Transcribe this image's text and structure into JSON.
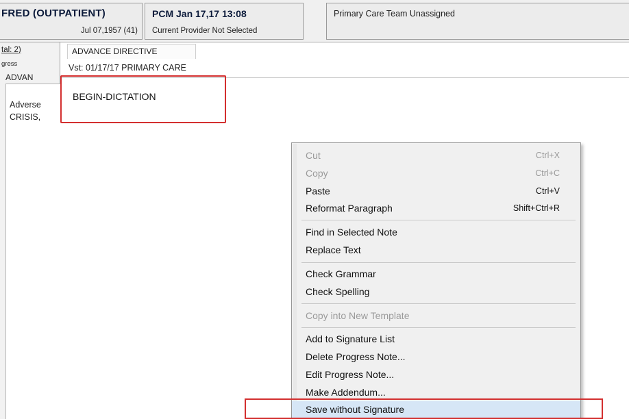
{
  "header": {
    "patient_name": "FRED (OUTPATIENT)",
    "patient_dob": "Jul 07,1957 (41)",
    "visit_title": "PCM Jan 17,17 13:08",
    "visit_provider": "Current Provider Not Selected",
    "team": "Primary Care Team Unassigned"
  },
  "left_panel": {
    "total_label": "tal: 2)",
    "progress_label": "gress",
    "selected_note": "ADVAN",
    "tree_line_1": "Adverse",
    "tree_line_2": "CRISIS,"
  },
  "note": {
    "title": "ADVANCE DIRECTIVE",
    "visit_line": "Vst: 01/17/17  PRIMARY CARE",
    "body_text": "BEGIN-DICTATION"
  },
  "context_menu": {
    "cut": {
      "label": "Cut",
      "shortcut": "Ctrl+X"
    },
    "copy": {
      "label": "Copy",
      "shortcut": "Ctrl+C"
    },
    "paste": {
      "label": "Paste",
      "shortcut": "Ctrl+V"
    },
    "reformat": {
      "label": "Reformat Paragraph",
      "shortcut": "Shift+Ctrl+R"
    },
    "find": {
      "label": "Find in Selected Note"
    },
    "replace": {
      "label": "Replace Text"
    },
    "grammar": {
      "label": "Check Grammar"
    },
    "spelling": {
      "label": "Check Spelling"
    },
    "copy_template": {
      "label": "Copy into New Template"
    },
    "add_signature": {
      "label": "Add to Signature List"
    },
    "delete_note": {
      "label": "Delete Progress Note..."
    },
    "edit_note": {
      "label": "Edit Progress Note..."
    },
    "addendum": {
      "label": "Make Addendum..."
    },
    "save_without_sig": {
      "label": "Save without Signature"
    }
  },
  "colors": {
    "highlight_outline": "#d32f2f",
    "menu_hover": "#d6e6f6",
    "header_text": "#0b1a3a"
  }
}
